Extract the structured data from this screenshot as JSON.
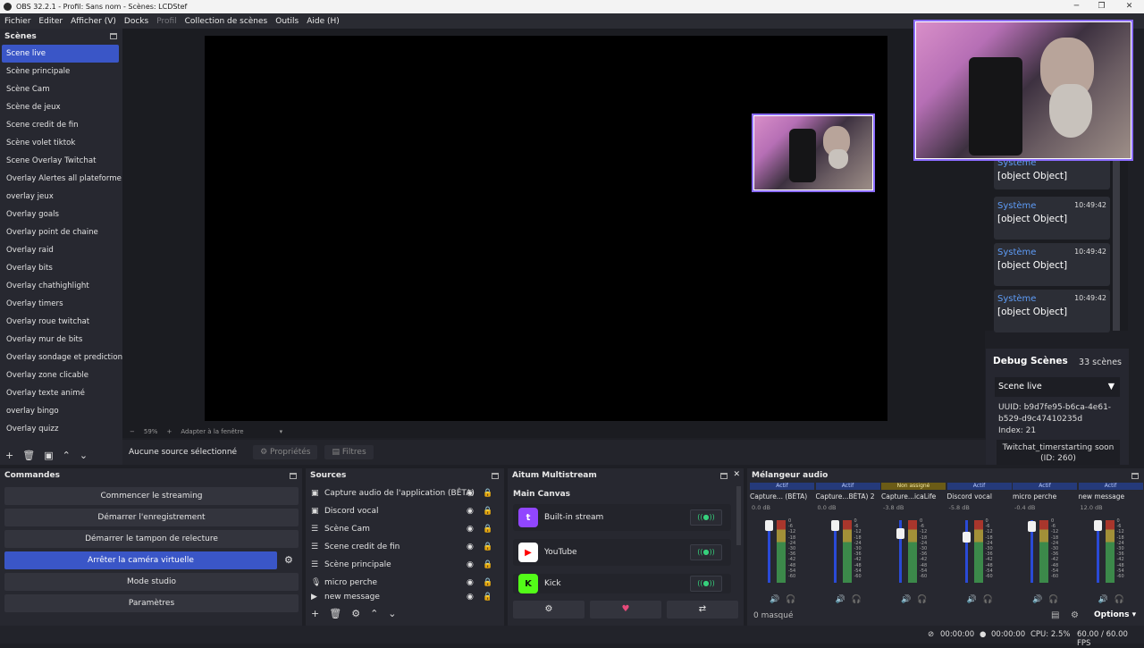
{
  "window": {
    "title": "OBS 32.2.1 - Profil: Sans nom - Scènes: LCDStef",
    "minimize": "─",
    "maximize": "❐",
    "close": "✕"
  },
  "menu": [
    "Fichier",
    "Editer",
    "Afficher (V)",
    "Docks",
    "Profil",
    "Collection de scènes",
    "Outils",
    "Aide (H)"
  ],
  "scenes": {
    "title": "Scènes",
    "items": [
      "Scene live",
      "Scène principale",
      "Scène Cam",
      "Scène de jeux",
      "Scene credit de fin",
      "Scène volet tiktok",
      "Scene Overlay Twitchat",
      "Overlay Alertes all plateforme",
      "overlay jeux",
      "Overlay goals",
      "Overlay point de chaine",
      "Overlay raid",
      "Overlay bits",
      "Overlay chathighlight",
      "Overlay timers",
      "Overlay roue twitchat",
      "Overlay mur de bits",
      "Overlay sondage et prediction",
      "Overlay zone clicable",
      "Overlay texte animé",
      "overlay bingo",
      "Overlay quizz"
    ],
    "selected_index": 0
  },
  "preview": {
    "zoom": "59%",
    "fit_label": "Adapter à la fenêtre"
  },
  "source_bar": {
    "label": "Aucune source sélectionné",
    "properties": "Propriétés",
    "filters": "Filtres"
  },
  "chat": {
    "messages": [
      {
        "author": "Système",
        "text": "[object Object]",
        "time": "10:49:42"
      },
      {
        "author": "Système",
        "text": "[object Object]",
        "time": "10:49:42"
      },
      {
        "author": "Système",
        "text": "[object Object]",
        "time": "10:49:42"
      }
    ],
    "partial_author": "Système",
    "partial_text": "[object Object]"
  },
  "debug": {
    "title": "Debug Scènes",
    "count": "33 scènes",
    "selected": "Scene live",
    "uuid": "UUID: b9d7fe95-b6ca-4e61-b529-d9c47410235d",
    "index": "Index: 21",
    "secondary": "Twitchat_timerstarting soon (ID: 260)"
  },
  "commands": {
    "title": "Commandes",
    "buttons": [
      "Commencer le streaming",
      "Démarrer l'enregistrement",
      "Démarrer le tampon de relecture",
      "Arrêter la caméra virtuelle",
      "Mode studio",
      "Paramètres"
    ]
  },
  "sources": {
    "title": "Sources",
    "items": [
      "Capture audio de l'application (BÊTA)",
      "Discord vocal",
      "Scène Cam",
      "Scene credit de fin",
      "Scène principale",
      "micro perche",
      "new message"
    ]
  },
  "multistream": {
    "title": "Aitum Multistream",
    "canvas": "Main Canvas",
    "services": [
      {
        "name": "Built-in stream",
        "color": "#9146ff",
        "glyph": "t"
      },
      {
        "name": "YouTube",
        "color": "#ff0000",
        "glyph": "▶"
      },
      {
        "name": "Kick",
        "color": "#53fc18",
        "glyph": "K"
      }
    ]
  },
  "mixer": {
    "title": "Mélangeur audio",
    "channels": [
      {
        "status": "Actif",
        "name": "Capture... (BÊTA)",
        "db": "0.0 dB",
        "level": 1.0
      },
      {
        "status": "Actif",
        "name": "Capture...BÊTA) 2",
        "db": "0.0 dB",
        "level": 1.0
      },
      {
        "status": "Non assigné",
        "name": "Capture...icaLife",
        "db": "-3.8 dB",
        "level": 0.85
      },
      {
        "status": "Actif",
        "name": "Discord vocal",
        "db": "-5.8 dB",
        "level": 0.78
      },
      {
        "status": "Actif",
        "name": "micro perche",
        "db": "-0.4 dB",
        "level": 0.98
      },
      {
        "status": "Actif",
        "name": "new message",
        "db": "12.0 dB",
        "level": 1.0
      }
    ],
    "scale": [
      "0",
      "-6",
      "-12",
      "-18",
      "-24",
      "-30",
      "-36",
      "-42",
      "-48",
      "-54",
      "-60"
    ],
    "hidden": "0 masqué",
    "options": "Options"
  },
  "status": {
    "rec_time": "00:00:00",
    "stream_time": "00:00:00",
    "cpu": "CPU: 2.5%",
    "fps": "60.00 / 60.00 FPS"
  }
}
